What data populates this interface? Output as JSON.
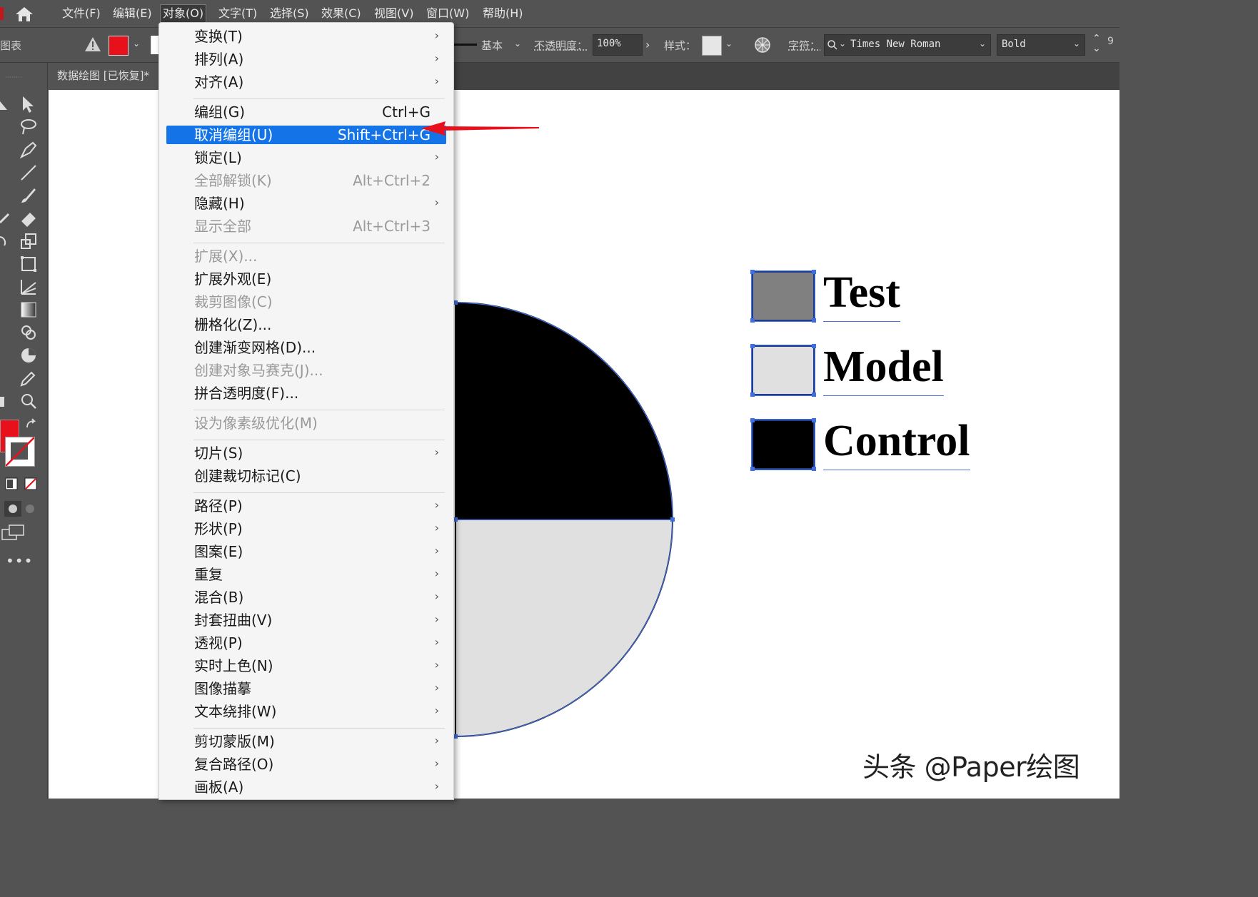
{
  "menubar": {
    "items": [
      "文件(F)",
      "编辑(E)",
      "对象(O)",
      "文字(T)",
      "选择(S)",
      "效果(C)",
      "视图(V)",
      "窗口(W)",
      "帮助(H)"
    ],
    "active_index": 2
  },
  "controlbar": {
    "left_label": "图表",
    "stroke_label": "基本",
    "opacity_label": "不透明度：",
    "opacity_value": "100%",
    "style_label": "样式：",
    "char_label": "字符：",
    "font_family": "Times New Roman",
    "font_style": "Bold",
    "size_partial": "9"
  },
  "tab": {
    "title": "数据绘图 [已恢复]*"
  },
  "dropdown": {
    "items": [
      {
        "label": "变换(T)",
        "shortcut": "",
        "submenu": true,
        "disabled": false
      },
      {
        "label": "排列(A)",
        "shortcut": "",
        "submenu": true,
        "disabled": false
      },
      {
        "label": "对齐(A)",
        "shortcut": "",
        "submenu": true,
        "disabled": false
      },
      {
        "label": "编组(G)",
        "shortcut": "Ctrl+G",
        "submenu": false,
        "disabled": false
      },
      {
        "label": "取消编组(U)",
        "shortcut": "Shift+Ctrl+G",
        "submenu": false,
        "disabled": false,
        "highlight": true
      },
      {
        "label": "锁定(L)",
        "shortcut": "",
        "submenu": true,
        "disabled": false
      },
      {
        "label": "全部解锁(K)",
        "shortcut": "Alt+Ctrl+2",
        "submenu": false,
        "disabled": true
      },
      {
        "label": "隐藏(H)",
        "shortcut": "",
        "submenu": true,
        "disabled": false
      },
      {
        "label": "显示全部",
        "shortcut": "Alt+Ctrl+3",
        "submenu": false,
        "disabled": true
      },
      {
        "label": "扩展(X)...",
        "shortcut": "",
        "submenu": false,
        "disabled": true
      },
      {
        "label": "扩展外观(E)",
        "shortcut": "",
        "submenu": false,
        "disabled": false
      },
      {
        "label": "裁剪图像(C)",
        "shortcut": "",
        "submenu": false,
        "disabled": true
      },
      {
        "label": "栅格化(Z)...",
        "shortcut": "",
        "submenu": false,
        "disabled": false
      },
      {
        "label": "创建渐变网格(D)...",
        "shortcut": "",
        "submenu": false,
        "disabled": false
      },
      {
        "label": "创建对象马赛克(J)...",
        "shortcut": "",
        "submenu": false,
        "disabled": true
      },
      {
        "label": "拼合透明度(F)...",
        "shortcut": "",
        "submenu": false,
        "disabled": false
      },
      {
        "label": "设为像素级优化(M)",
        "shortcut": "",
        "submenu": false,
        "disabled": true
      },
      {
        "label": "切片(S)",
        "shortcut": "",
        "submenu": true,
        "disabled": false
      },
      {
        "label": "创建裁切标记(C)",
        "shortcut": "",
        "submenu": false,
        "disabled": false
      },
      {
        "label": "路径(P)",
        "shortcut": "",
        "submenu": true,
        "disabled": false
      },
      {
        "label": "形状(P)",
        "shortcut": "",
        "submenu": true,
        "disabled": false
      },
      {
        "label": "图案(E)",
        "shortcut": "",
        "submenu": true,
        "disabled": false
      },
      {
        "label": "重复",
        "shortcut": "",
        "submenu": true,
        "disabled": false
      },
      {
        "label": "混合(B)",
        "shortcut": "",
        "submenu": true,
        "disabled": false
      },
      {
        "label": "封套扭曲(V)",
        "shortcut": "",
        "submenu": true,
        "disabled": false
      },
      {
        "label": "透视(P)",
        "shortcut": "",
        "submenu": true,
        "disabled": false
      },
      {
        "label": "实时上色(N)",
        "shortcut": "",
        "submenu": true,
        "disabled": false
      },
      {
        "label": "图像描摹",
        "shortcut": "",
        "submenu": true,
        "disabled": false
      },
      {
        "label": "文本绕排(W)",
        "shortcut": "",
        "submenu": true,
        "disabled": false
      },
      {
        "label": "剪切蒙版(M)",
        "shortcut": "",
        "submenu": true,
        "disabled": false
      },
      {
        "label": "复合路径(O)",
        "shortcut": "",
        "submenu": true,
        "disabled": false
      },
      {
        "label": "画板(A)",
        "shortcut": "",
        "submenu": true,
        "disabled": false
      }
    ]
  },
  "legend": [
    {
      "label": "Test",
      "color": "#808080"
    },
    {
      "label": "Model",
      "color": "#e0e0e0"
    },
    {
      "label": "Control",
      "color": "#000000"
    }
  ],
  "watermark": "头条 @Paper绘图",
  "colors": {
    "fill": "#e8111b",
    "highlight": "#1473e6",
    "annotation_arrow": "#e8111b",
    "selection": "#3f6ee0"
  }
}
